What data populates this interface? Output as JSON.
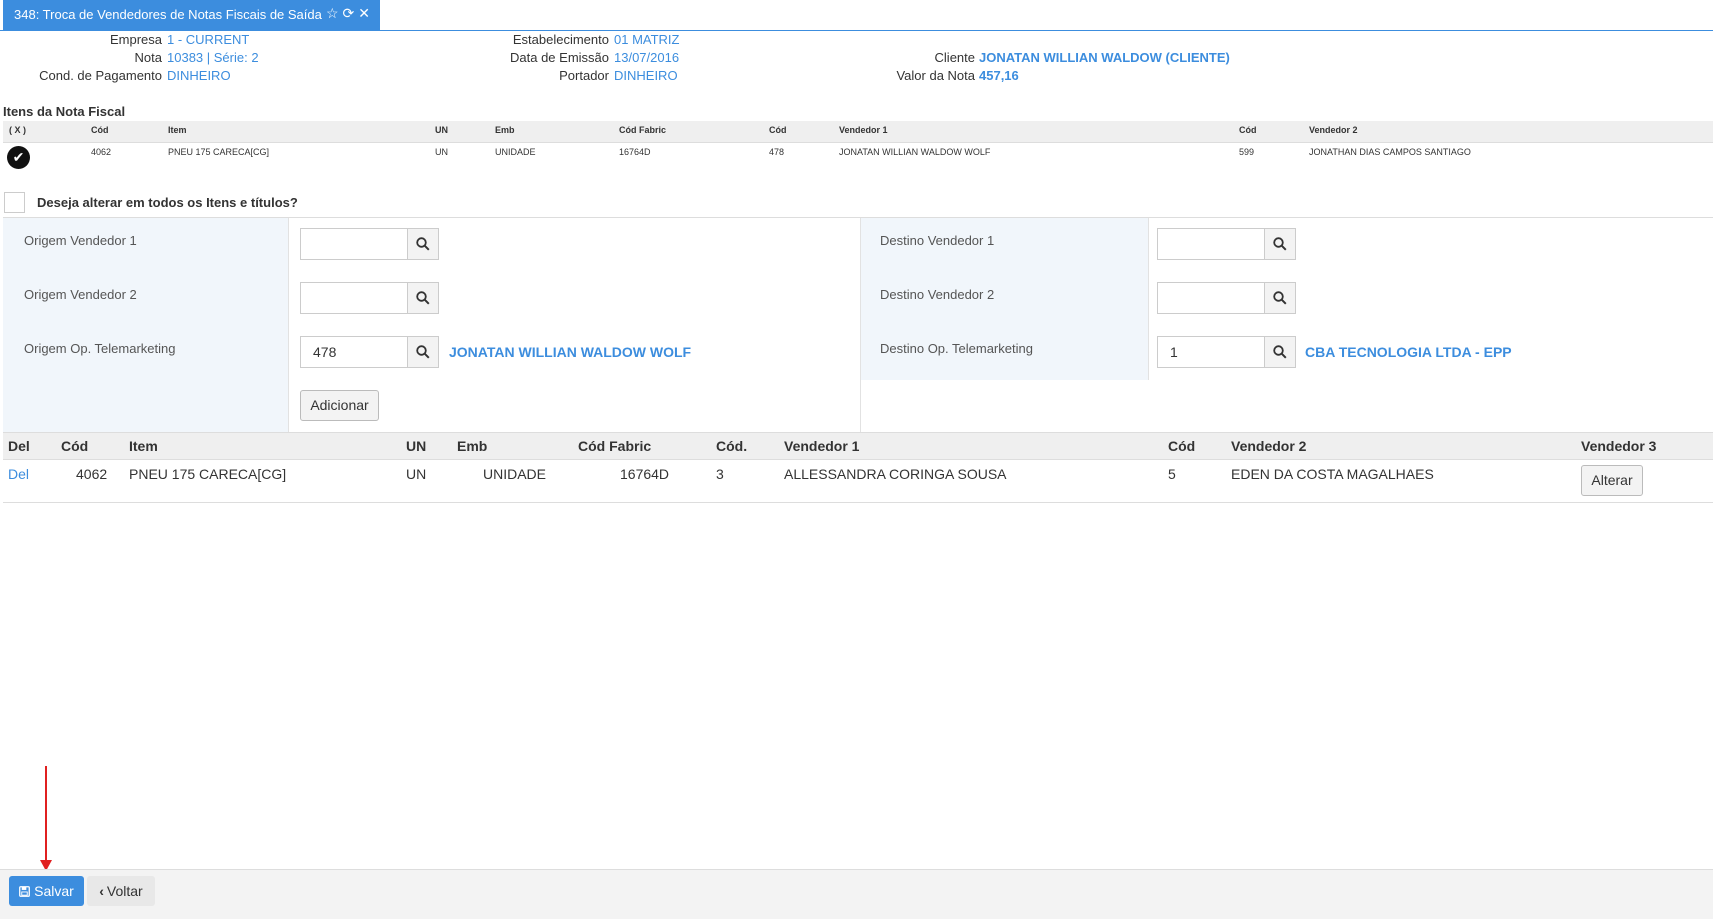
{
  "tab": {
    "title": "348: Troca de Vendedores de Notas Fiscais de Saída",
    "icons": [
      "star-icon",
      "refresh-icon",
      "close-icon"
    ]
  },
  "header": {
    "empresa_label": "Empresa",
    "empresa": "1 - CURRENT",
    "nota_label": "Nota",
    "nota": "10383 | Série: 2",
    "pagamento_label": "Cond. de Pagamento",
    "pagamento": "DINHEIRO",
    "estab_label": "Estabelecimento",
    "estab": "01 MATRIZ",
    "emissao_label": "Data de Emissão",
    "emissao": "13/07/2016",
    "portador_label": "Portador",
    "portador": "DINHEIRO",
    "cliente_label": "Cliente",
    "cliente": "JONATAN WILLIAN WALDOW (CLIENTE)",
    "valor_label": "Valor da Nota",
    "valor": "457,16"
  },
  "itens": {
    "title": "Itens da Nota Fiscal",
    "headers": [
      "( X )",
      "Cód",
      "Item",
      "UN",
      "Emb",
      "Cód Fabric",
      "Cód",
      "Vendedor 1",
      "Cód",
      "Vendedor 2"
    ],
    "row": [
      "4062",
      "PNEU 175 CARECA[CG]",
      "UN",
      "UNIDADE",
      "16764D",
      "478",
      "JONATAN WILLIAN WALDOW WOLF",
      "599",
      "JONATHAN DIAS CAMPOS SANTIAGO"
    ]
  },
  "alterar_todos": "Deseja alterar em todos os Itens e títulos?",
  "form": {
    "origem_v1": "Origem Vendedor 1",
    "origem_v2": "Origem Vendedor 2",
    "origem_tele": "Origem Op. Telemarketing",
    "origem_tele_value": "478",
    "origem_tele_name": "JONATAN WILLIAN WALDOW WOLF",
    "destino_v1": "Destino Vendedor 1",
    "destino_v2": "Destino Vendedor 2",
    "destino_tele": "Destino Op. Telemarketing",
    "destino_tele_value": "1",
    "destino_tele_name": "CBA TECNOLOGIA LTDA - EPP",
    "adicionar": "Adicionar"
  },
  "tabela": {
    "headers": [
      "Del",
      "Cód",
      "Item",
      "UN",
      "Emb",
      "Cód Fabric",
      "Cód.",
      "Vendedor 1",
      "Cód",
      "Vendedor 2",
      "Vendedor 3"
    ],
    "row": [
      "Del",
      "4062",
      "PNEU 175 CARECA[CG]",
      "UN",
      "UNIDADE",
      "16764D",
      "3",
      "ALLESSANDRA CORINGA SOUSA",
      "5",
      "EDEN DA COSTA MAGALHAES",
      "Alterar"
    ]
  },
  "footer": {
    "salvar": "Salvar",
    "voltar": "Voltar"
  },
  "colors": {
    "accent": "#3c8dde",
    "annotation": "#e02020"
  }
}
